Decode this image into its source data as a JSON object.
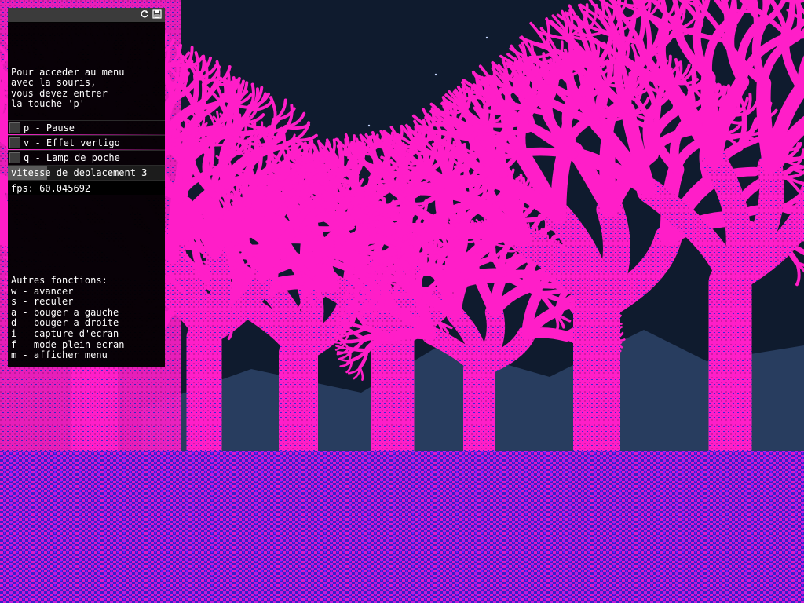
{
  "scene": {
    "description_icons": [
      "tree-icon"
    ],
    "colors": {
      "sky": "#0f1b2e",
      "mountain": "#283d5f",
      "tree_pink": "#ff1ec8",
      "tree_light": "#ffb0ec",
      "ground_blue": "#3a1ec8",
      "ground_pink": "#e018c8",
      "star": "#c8d8ff"
    }
  },
  "titlebar": {
    "icons": [
      "refresh-icon",
      "save-icon"
    ]
  },
  "menu": {
    "intro_text": "Pour acceder au menu\navec la souris,\nvous devez entrer\nla touche 'p'",
    "toggles": [
      {
        "label": "p - Pause",
        "checked": false
      },
      {
        "label": "v - Effet vertigo",
        "checked": false
      },
      {
        "label": "q - Lamp de poche",
        "checked": false
      }
    ],
    "speed": {
      "label": "vitesse de deplacement 3",
      "fill_fraction": 0.25
    },
    "fps": "fps: 60.045692",
    "other_functions": "Autres fonctions:\nw - avancer\ns - reculer\na - bouger a gauche\nd - bouger a droite\ni - capture d'ecran\nf - mode plein ecran\nm - afficher menu"
  }
}
